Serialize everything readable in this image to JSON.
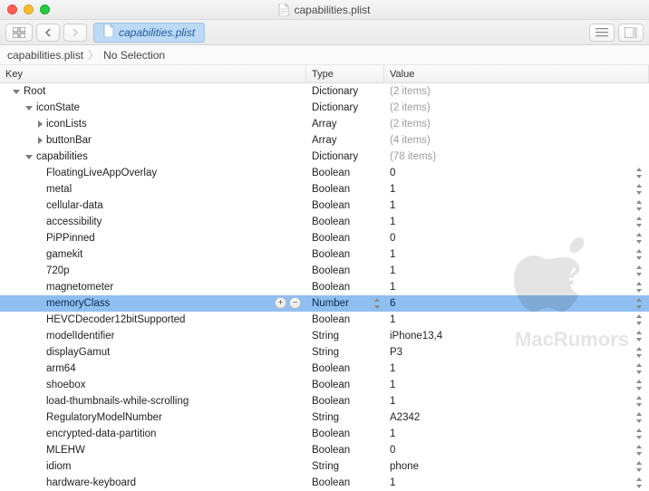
{
  "window": {
    "title": "capabilities.plist"
  },
  "tab": {
    "label": "capabilities.plist"
  },
  "breadcrumb": {
    "file": "capabilities.plist",
    "selection": "No Selection"
  },
  "columns": {
    "key": "Key",
    "type": "Type",
    "value": "Value"
  },
  "watermark": "MacRumors",
  "rows": [
    {
      "indent": 0,
      "disclosure": "down",
      "key": "Root",
      "type": "Dictionary",
      "value": "(2 items)",
      "dim_value": true,
      "stepper": false
    },
    {
      "indent": 1,
      "disclosure": "down",
      "key": "iconState",
      "type": "Dictionary",
      "value": "(2 items)",
      "dim_value": true,
      "stepper": false
    },
    {
      "indent": 2,
      "disclosure": "right",
      "key": "iconLists",
      "type": "Array",
      "value": "(2 items)",
      "dim_value": true,
      "stepper": false
    },
    {
      "indent": 2,
      "disclosure": "right",
      "key": "buttonBar",
      "type": "Array",
      "value": "(4 items)",
      "dim_value": true,
      "stepper": false
    },
    {
      "indent": 1,
      "disclosure": "down",
      "key": "capabilities",
      "type": "Dictionary",
      "value": "(78 items)",
      "dim_value": true,
      "stepper": false
    },
    {
      "indent": 2,
      "disclosure": "none",
      "key": "FloatingLiveAppOverlay",
      "type": "Boolean",
      "value": "0",
      "dim_value": false,
      "stepper": true
    },
    {
      "indent": 2,
      "disclosure": "none",
      "key": "metal",
      "type": "Boolean",
      "value": "1",
      "dim_value": false,
      "stepper": true
    },
    {
      "indent": 2,
      "disclosure": "none",
      "key": "cellular-data",
      "type": "Boolean",
      "value": "1",
      "dim_value": false,
      "stepper": true
    },
    {
      "indent": 2,
      "disclosure": "none",
      "key": "accessibility",
      "type": "Boolean",
      "value": "1",
      "dim_value": false,
      "stepper": true
    },
    {
      "indent": 2,
      "disclosure": "none",
      "key": "PiPPinned",
      "type": "Boolean",
      "value": "0",
      "dim_value": false,
      "stepper": true
    },
    {
      "indent": 2,
      "disclosure": "none",
      "key": "gamekit",
      "type": "Boolean",
      "value": "1",
      "dim_value": false,
      "stepper": true
    },
    {
      "indent": 2,
      "disclosure": "none",
      "key": "720p",
      "type": "Boolean",
      "value": "1",
      "dim_value": false,
      "stepper": true
    },
    {
      "indent": 2,
      "disclosure": "none",
      "key": "magnetometer",
      "type": "Boolean",
      "value": "1",
      "dim_value": false,
      "stepper": true
    },
    {
      "indent": 2,
      "disclosure": "none",
      "key": "memoryClass",
      "type": "Number",
      "value": "6",
      "dim_value": false,
      "stepper": true,
      "selected": true
    },
    {
      "indent": 2,
      "disclosure": "none",
      "key": "HEVCDecoder12bitSupported",
      "type": "Boolean",
      "value": "1",
      "dim_value": false,
      "stepper": true
    },
    {
      "indent": 2,
      "disclosure": "none",
      "key": "modelIdentifier",
      "type": "String",
      "value": "iPhone13,4",
      "dim_value": false,
      "stepper": true
    },
    {
      "indent": 2,
      "disclosure": "none",
      "key": "displayGamut",
      "type": "String",
      "value": "P3",
      "dim_value": false,
      "stepper": true
    },
    {
      "indent": 2,
      "disclosure": "none",
      "key": "arm64",
      "type": "Boolean",
      "value": "1",
      "dim_value": false,
      "stepper": true
    },
    {
      "indent": 2,
      "disclosure": "none",
      "key": "shoebox",
      "type": "Boolean",
      "value": "1",
      "dim_value": false,
      "stepper": true
    },
    {
      "indent": 2,
      "disclosure": "none",
      "key": "load-thumbnails-while-scrolling",
      "type": "Boolean",
      "value": "1",
      "dim_value": false,
      "stepper": true
    },
    {
      "indent": 2,
      "disclosure": "none",
      "key": "RegulatoryModelNumber",
      "type": "String",
      "value": "A2342",
      "dim_value": false,
      "stepper": true
    },
    {
      "indent": 2,
      "disclosure": "none",
      "key": "encrypted-data-partition",
      "type": "Boolean",
      "value": "1",
      "dim_value": false,
      "stepper": true
    },
    {
      "indent": 2,
      "disclosure": "none",
      "key": "MLEHW",
      "type": "Boolean",
      "value": "0",
      "dim_value": false,
      "stepper": true
    },
    {
      "indent": 2,
      "disclosure": "none",
      "key": "idiom",
      "type": "String",
      "value": "phone",
      "dim_value": false,
      "stepper": true
    },
    {
      "indent": 2,
      "disclosure": "none",
      "key": "hardware-keyboard",
      "type": "Boolean",
      "value": "1",
      "dim_value": false,
      "stepper": true
    }
  ]
}
